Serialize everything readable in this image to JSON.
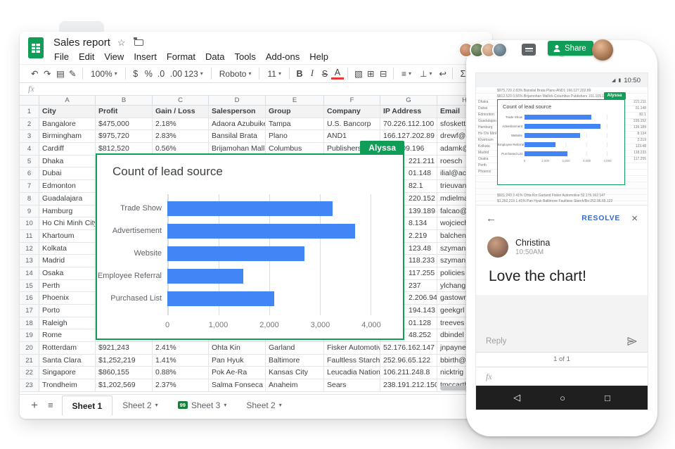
{
  "ui": {
    "caret_icon": "▾"
  },
  "window": {
    "doc_title": "Sales report",
    "star_icon": "☆",
    "menu": [
      "File",
      "Edit",
      "View",
      "Insert",
      "Format",
      "Data",
      "Tools",
      "Add-ons",
      "Help"
    ],
    "share_label": "Share",
    "avatars": [
      "#c77b4a",
      "#4e6e3c",
      "#d8a27a",
      "#5f7a8a"
    ],
    "accent_green": "#0f9d58"
  },
  "toolbar": {
    "zoom": "100%",
    "font": "Roboto",
    "font_size": "11",
    "items": [
      {
        "type": "icon",
        "name": "undo-icon",
        "glyph": "↶"
      },
      {
        "type": "icon",
        "name": "redo-icon",
        "glyph": "↷"
      },
      {
        "type": "icon",
        "name": "print-icon",
        "glyph": "▤"
      },
      {
        "type": "icon",
        "name": "paint-format-icon",
        "glyph": "✎"
      },
      {
        "type": "sep"
      },
      {
        "type": "select",
        "name": "zoom-select",
        "label": "100%"
      },
      {
        "type": "sep"
      },
      {
        "type": "icon",
        "name": "currency-icon",
        "glyph": "$"
      },
      {
        "type": "icon",
        "name": "percent-icon",
        "glyph": "%"
      },
      {
        "type": "icon",
        "name": "decrease-decimal-icon",
        "glyph": ".0"
      },
      {
        "type": "icon",
        "name": "increase-decimal-icon",
        "glyph": ".00"
      },
      {
        "type": "select",
        "name": "number-format-select",
        "label": "123"
      },
      {
        "type": "sep"
      },
      {
        "type": "select",
        "name": "font-select",
        "label": "Roboto"
      },
      {
        "type": "sep"
      },
      {
        "type": "select",
        "name": "font-size-select",
        "label": "11"
      },
      {
        "type": "sep"
      },
      {
        "type": "icon",
        "name": "bold-icon",
        "glyph": "B",
        "cls": "b"
      },
      {
        "type": "icon",
        "name": "italic-icon",
        "glyph": "I",
        "cls": "i"
      },
      {
        "type": "icon",
        "name": "strikethrough-icon",
        "glyph": "S",
        "cls": "strike"
      },
      {
        "type": "icon",
        "name": "text-color-icon",
        "glyph": "A",
        "cls": "tcolor"
      },
      {
        "type": "sep"
      },
      {
        "type": "icon",
        "name": "fill-color-icon",
        "glyph": "▧"
      },
      {
        "type": "icon",
        "name": "borders-icon",
        "glyph": "⊞"
      },
      {
        "type": "icon",
        "name": "merge-cells-icon",
        "glyph": "⊟"
      },
      {
        "type": "sep"
      },
      {
        "type": "select",
        "name": "horizontal-align-select",
        "label": "≡"
      },
      {
        "type": "select",
        "name": "vertical-align-select",
        "label": "⊥"
      },
      {
        "type": "icon",
        "name": "text-wrap-icon",
        "glyph": "↩"
      },
      {
        "type": "sep"
      },
      {
        "type": "icon",
        "name": "functions-icon",
        "glyph": "Σ"
      },
      {
        "type": "icon",
        "name": "filter-icon",
        "glyph": "∇"
      },
      {
        "type": "icon",
        "name": "insert-chart-icon",
        "glyph": "▦"
      },
      {
        "type": "icon",
        "name": "more-icon",
        "glyph": "▾"
      }
    ]
  },
  "formula_bar": {
    "fx": "fx"
  },
  "grid": {
    "columns": [
      "A",
      "B",
      "C",
      "D",
      "E",
      "F",
      "G",
      "H"
    ],
    "rows": [
      [
        "City",
        "Profit",
        "Gain / Loss",
        "Salesperson",
        "Group",
        "Company",
        "IP Address",
        "Email"
      ],
      [
        "Bangalore",
        "$475,000",
        "2.18%",
        "Adaora Azubuike",
        "Tampa",
        "U.S. Bancorp",
        "70.226.112.100",
        "sfoskett"
      ],
      [
        "Birmingham",
        "$975,720",
        "2.83%",
        "Bansilal Brata",
        "Plano",
        "AND1",
        "166.127.202.89",
        "drewf@"
      ],
      [
        "Cardiff",
        "$812,520",
        "0.56%",
        "Brijamohan Mallick",
        "Columbus",
        "Publishers",
        "101.109.196",
        "adamk@"
      ],
      [
        "Dhaka",
        "",
        "",
        "",
        "",
        "",
        "221.211",
        "roesch"
      ],
      [
        "Dubai",
        "",
        "",
        "",
        "",
        "",
        "01.148",
        "ilial@ac"
      ],
      [
        "Edmonton",
        "",
        "",
        "",
        "",
        "",
        "82.1",
        "trieuvan"
      ],
      [
        "Guadalajara",
        "",
        "",
        "",
        "",
        "",
        "220.152",
        "mdielma"
      ],
      [
        "Hamburg",
        "",
        "",
        "",
        "",
        "",
        "139.189",
        "falcao@"
      ],
      [
        "Ho Chi Minh City",
        "",
        "",
        "",
        "",
        "",
        "8.134",
        "wojciech"
      ],
      [
        "Khartoum",
        "",
        "",
        "",
        "",
        "",
        "2.219",
        "balchen"
      ],
      [
        "Kolkata",
        "",
        "",
        "",
        "",
        "",
        "123.48",
        "szymans"
      ],
      [
        "Madrid",
        "",
        "",
        "",
        "",
        "",
        "118.233",
        "szyman"
      ],
      [
        "Osaka",
        "",
        "",
        "",
        "",
        "",
        "117.255",
        "policies"
      ],
      [
        "Perth",
        "",
        "",
        "",
        "",
        "",
        "237",
        "ylchang"
      ],
      [
        "Phoenix",
        "",
        "",
        "",
        "",
        "",
        "2.206.94",
        "gastown"
      ],
      [
        "Porto",
        "",
        "",
        "",
        "",
        "",
        "194.143",
        "geekgrl"
      ],
      [
        "Raleigh",
        "",
        "",
        "",
        "",
        "",
        "01.128",
        "treeves"
      ],
      [
        "Rome",
        "",
        "",
        "",
        "",
        "",
        "48.252",
        "dbindel"
      ],
      [
        "Rotterdam",
        "$921,243",
        "2.41%",
        "Ohta Kin",
        "Garland",
        "Fisker Automotive",
        "52.176.162.147",
        "jnpayne"
      ],
      [
        "Santa Clara",
        "$1,252,219",
        "1.41%",
        "Pan Hyuk",
        "Baltimore",
        "Faultless Starch/Bo",
        "252.96.65.122",
        "bbirth@"
      ],
      [
        "Singapore",
        "$860,155",
        "0.88%",
        "Pok Ae-Ra",
        "Kansas City",
        "Leucadia National",
        "106.211.248.8",
        "nicktrig"
      ],
      [
        "Trondheim",
        "$1,202,569",
        "2.37%",
        "Salma Fonseca",
        "Anaheim",
        "Sears",
        "238.191.212.150",
        "tmccarth"
      ]
    ]
  },
  "chart": {
    "owner": "Alyssa"
  },
  "chart_data": {
    "type": "bar",
    "orientation": "horizontal",
    "title": "Count of lead source",
    "categories": [
      "Trade Show",
      "Advertisement",
      "Website",
      "Employee Referral",
      "Purchased List"
    ],
    "values": [
      3250,
      3700,
      2700,
      1500,
      2100
    ],
    "xlim": [
      0,
      4000
    ],
    "xticks": [
      "0",
      "1,000",
      "2,000",
      "3,000",
      "4,000"
    ],
    "bar_color": "#4285f4",
    "border_color": "#0f9d58",
    "legend": "none",
    "grid": "vertical"
  },
  "sheet_bar": {
    "add_icon": "+",
    "all_sheets_icon": "≡",
    "tabs": [
      {
        "label": "Sheet 1",
        "active": true
      },
      {
        "label": "Sheet 2",
        "active": false
      },
      {
        "label": "Sheet 3",
        "active": false,
        "badge": "99"
      },
      {
        "label": "Sheet 2",
        "active": false
      }
    ]
  },
  "phone": {
    "signal_icon": "◢",
    "battery_icon": "▮",
    "status_time": "10:50",
    "back_icon": "←",
    "resolve_label": "RESOLVE",
    "close_icon": "×",
    "comment": {
      "author": "Christina",
      "time": "10:50AM",
      "text": "Love the chart!"
    },
    "reply_placeholder": "Reply",
    "pager": "1 of 1",
    "fx": "fx",
    "nav": {
      "back_icon": "◁",
      "home_icon": "○",
      "recents_icon": "□"
    },
    "mini": {
      "top_rows": [
        "$975,720   2.83%   Bansilal Brata   Plano   AND1   166.127.202.89",
        "$812,520   0.56%   Brijamohan Mallick   Columbus   Publishers   101.109.196"
      ],
      "cities": [
        "Dhaka",
        "Dubai",
        "Edmonton",
        "Guadalajara",
        "Hamburg",
        "Ho Chi Minh City",
        "Khartoum",
        "Kolkata",
        "Madrid",
        "Osaka",
        "Perth",
        "Phoenix"
      ],
      "right_nums": [
        "221.211",
        "01.148",
        "82.1",
        "220.152",
        "139.189",
        "8.134",
        "2.219",
        "123.48",
        "118.233",
        "117.255"
      ],
      "bottom_rows": [
        "$921,243   2.41%   Ohta Kin   Garland   Fisker Automotive   52.176.162.147",
        "$1,252,219   1.41%   Pan Hyuk   Baltimore   Faultless Starch/Bo   252.96.65.122"
      ]
    }
  }
}
